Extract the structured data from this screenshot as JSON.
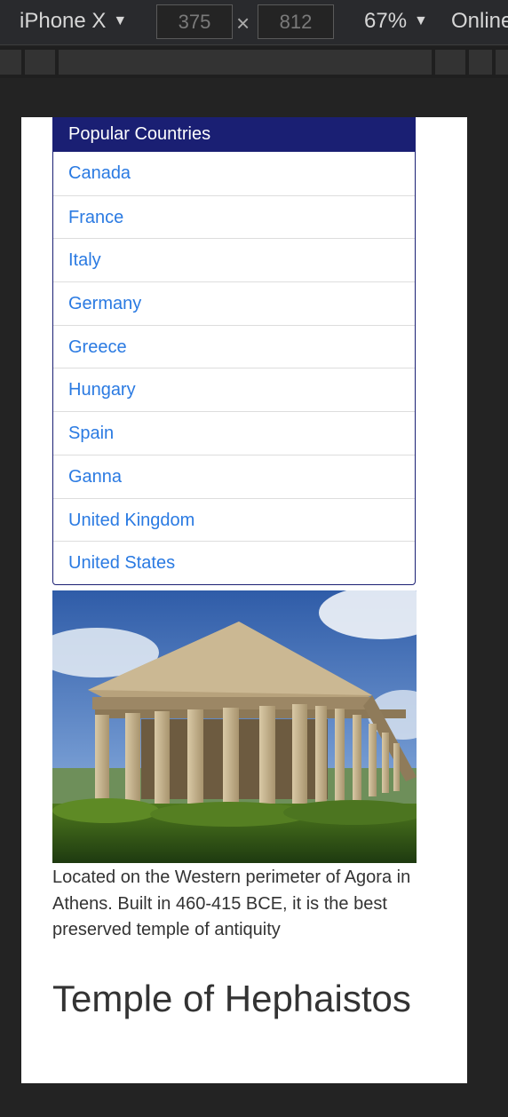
{
  "toolbar": {
    "device": "iPhone X",
    "width": "375",
    "times": "×",
    "height": "812",
    "zoom": "67%",
    "throttle": "Online",
    "caret": "▼"
  },
  "sidebar": {
    "header": "Popular Countries",
    "items": [
      {
        "label": "Canada"
      },
      {
        "label": "France"
      },
      {
        "label": "Italy"
      },
      {
        "label": "Germany"
      },
      {
        "label": "Greece"
      },
      {
        "label": "Hungary"
      },
      {
        "label": "Spain"
      },
      {
        "label": "Ganna"
      },
      {
        "label": "United Kingdom"
      },
      {
        "label": "United States"
      }
    ]
  },
  "article": {
    "caption": "Located on the Western perimeter of Agora in Athens. Built in 460-415 BCE, it is the best preserved temple of antiquity",
    "title": "Temple of Hephaistos"
  },
  "colors": {
    "header_bg": "#1a1f73",
    "link": "#2a7ae2",
    "text": "#333333"
  }
}
